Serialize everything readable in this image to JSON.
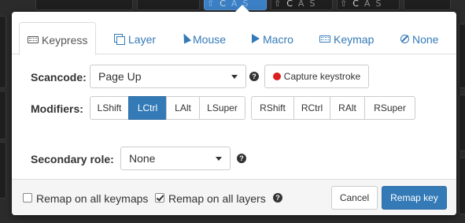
{
  "background_keys": [
    {
      "mods": [
        "",
        "",
        "",
        ""
      ],
      "selected": false
    },
    {
      "mods": [
        "",
        "",
        "",
        ""
      ],
      "selected": false
    },
    {
      "mods": [
        "⇧",
        "C",
        "A",
        "S"
      ],
      "selected": true
    },
    {
      "mods": [
        "⇧",
        "C",
        "A",
        "S"
      ],
      "selected": false
    },
    {
      "mods": [
        "⇧",
        "C",
        "A",
        "S"
      ],
      "selected": false
    },
    {
      "mods": [
        "",
        "",
        "",
        ""
      ],
      "selected": false
    }
  ],
  "tabs": [
    {
      "label": "Keypress",
      "icon": "keyboard-icon",
      "active": true
    },
    {
      "label": "Layer",
      "icon": "layers-icon",
      "active": false
    },
    {
      "label": "Mouse",
      "icon": "mouse-pointer-icon",
      "active": false
    },
    {
      "label": "Macro",
      "icon": "play-icon",
      "active": false
    },
    {
      "label": "Keymap",
      "icon": "keyboard-icon",
      "active": false
    },
    {
      "label": "None",
      "icon": "ban-icon",
      "active": false
    }
  ],
  "scancode": {
    "label": "Scancode:",
    "value": "Page Up",
    "help": "?",
    "capture_label": "Capture keystroke"
  },
  "modifiers": {
    "label": "Modifiers:",
    "left": [
      {
        "label": "LShift",
        "active": false
      },
      {
        "label": "LCtrl",
        "active": true
      },
      {
        "label": "LAlt",
        "active": false
      },
      {
        "label": "LSuper",
        "active": false
      }
    ],
    "right": [
      {
        "label": "RShift",
        "active": false
      },
      {
        "label": "RCtrl",
        "active": false
      },
      {
        "label": "RAlt",
        "active": false
      },
      {
        "label": "RSuper",
        "active": false
      }
    ]
  },
  "secondary_role": {
    "label": "Secondary role:",
    "value": "None",
    "help": "?"
  },
  "footer": {
    "remap_all_keymaps": {
      "label": "Remap on all keymaps",
      "checked": false
    },
    "remap_all_layers": {
      "label": "Remap on all layers",
      "checked": true
    },
    "help": "?",
    "cancel_label": "Cancel",
    "remap_label": "Remap key"
  },
  "colors": {
    "accent": "#337ab7",
    "record": "#d9201f",
    "background": "#2b2b2b"
  }
}
